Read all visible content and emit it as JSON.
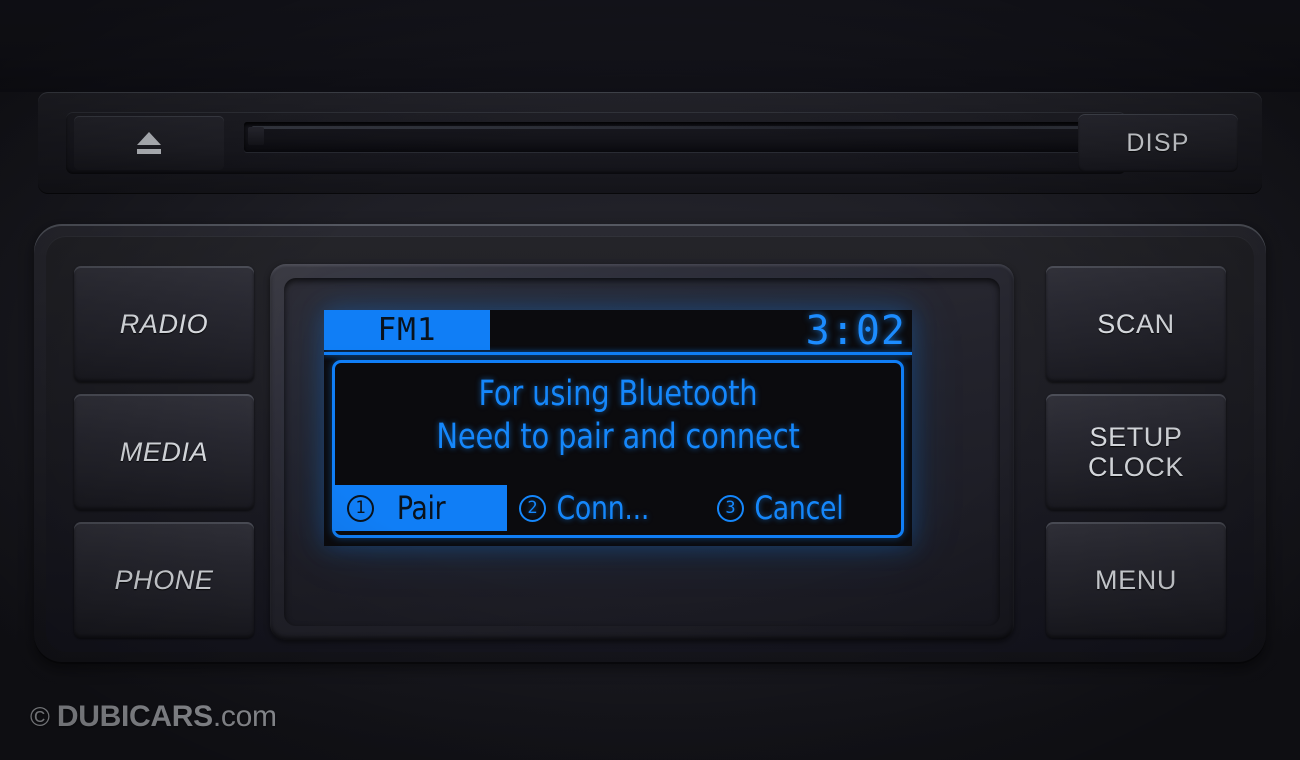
{
  "device": {
    "name": "Car audio head unit",
    "colors": {
      "lcd_blue": "#107ef6",
      "lcd_text_blue": "#1587fb",
      "lcd_background": "#0b0b0e",
      "button_label": "#e6e9ee",
      "bezel_dark": "#22222a"
    }
  },
  "cd_panel": {
    "eject_icon": "eject-icon",
    "slot_name": "cd-slot",
    "disp_label": "DISP"
  },
  "left_buttons": [
    {
      "label": "RADIO",
      "name": "radio-button"
    },
    {
      "label": "MEDIA",
      "name": "media-button"
    },
    {
      "label": "PHONE",
      "name": "phone-button"
    }
  ],
  "right_buttons": [
    {
      "label": "SCAN",
      "name": "scan-button"
    },
    {
      "label": "SETUP\nCLOCK",
      "name": "setup-clock-button"
    },
    {
      "label": "MENU",
      "name": "menu-button"
    }
  ],
  "lcd": {
    "status": {
      "source": "FM1",
      "clock": "3:02"
    },
    "dialog": {
      "line1": "For using Bluetooth",
      "line2": "Need to pair and connect",
      "options": [
        {
          "number": "1",
          "label": "Pair",
          "selected": true
        },
        {
          "number": "2",
          "label": "Conn...",
          "selected": false
        },
        {
          "number": "3",
          "label": "Cancel",
          "selected": false
        }
      ]
    }
  },
  "watermark": {
    "copyright": "©",
    "brand": "DUBICARS",
    "tld": ".com"
  }
}
